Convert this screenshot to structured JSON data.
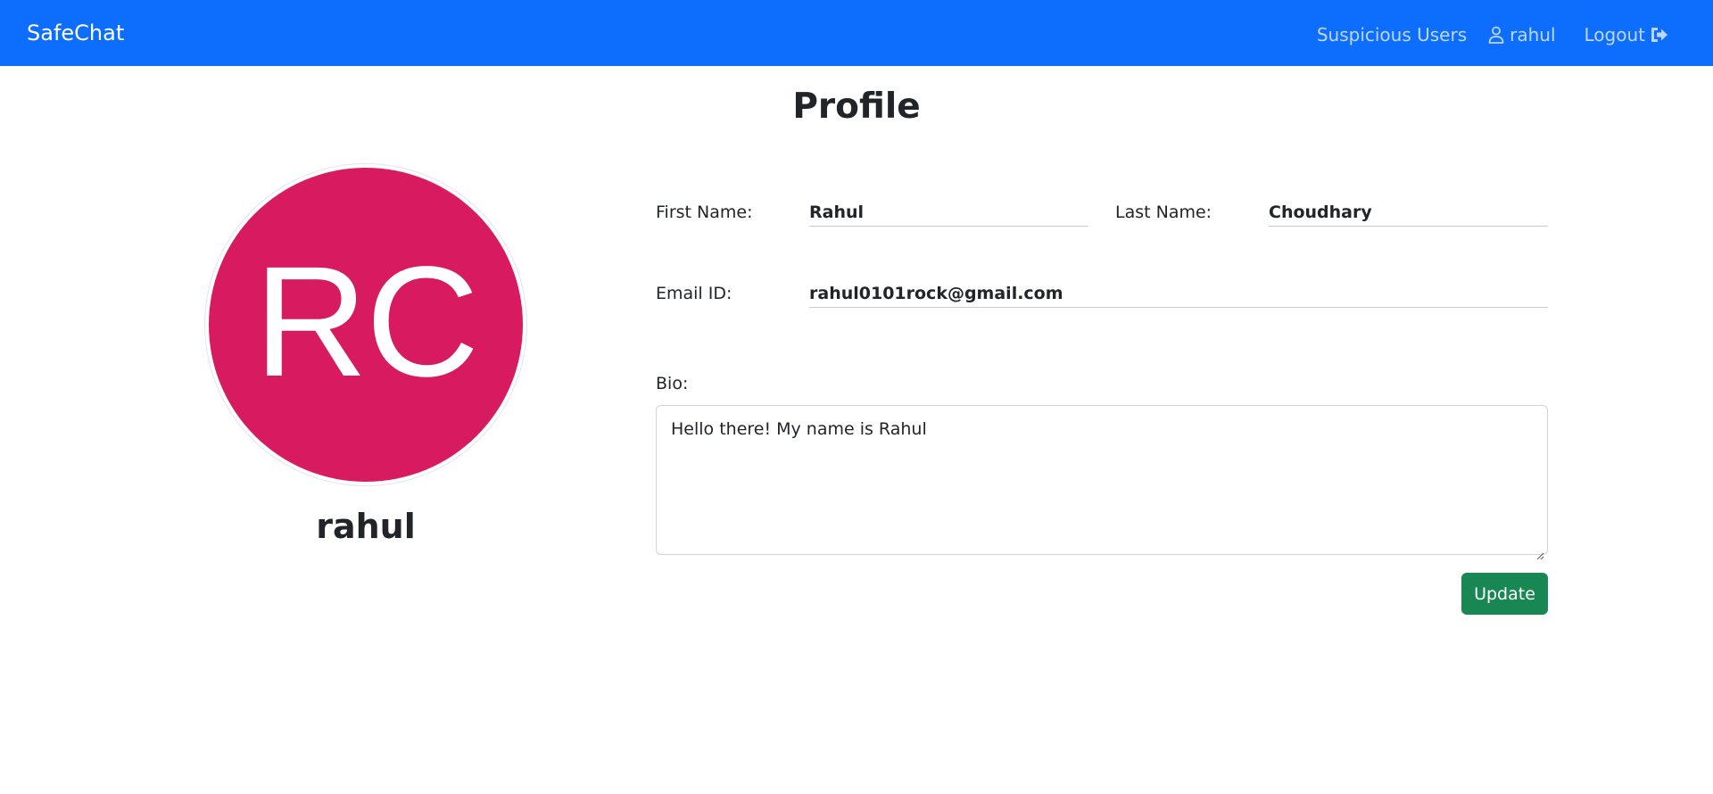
{
  "navbar": {
    "brand": "SafeChat",
    "links": {
      "suspicious_users": "Suspicious Users",
      "user": "rahul",
      "logout": "Logout"
    },
    "background_color": "#0d6efd"
  },
  "page": {
    "title": "Profile"
  },
  "profile": {
    "avatar_initials": "RC",
    "avatar_color": "#d81b60",
    "username": "rahul"
  },
  "form": {
    "first_name_label": "First Name:",
    "first_name_value": "Rahul",
    "last_name_label": "Last Name:",
    "last_name_value": "Choudhary",
    "email_label": "Email ID:",
    "email_value": "rahul0101rock@gmail.com",
    "bio_label": "Bio:",
    "bio_value": "Hello there! My name is Rahul",
    "update_button": "Update",
    "update_button_color": "#198754"
  },
  "icons": {
    "user": "user-outline-icon",
    "logout": "sign-out-icon"
  }
}
